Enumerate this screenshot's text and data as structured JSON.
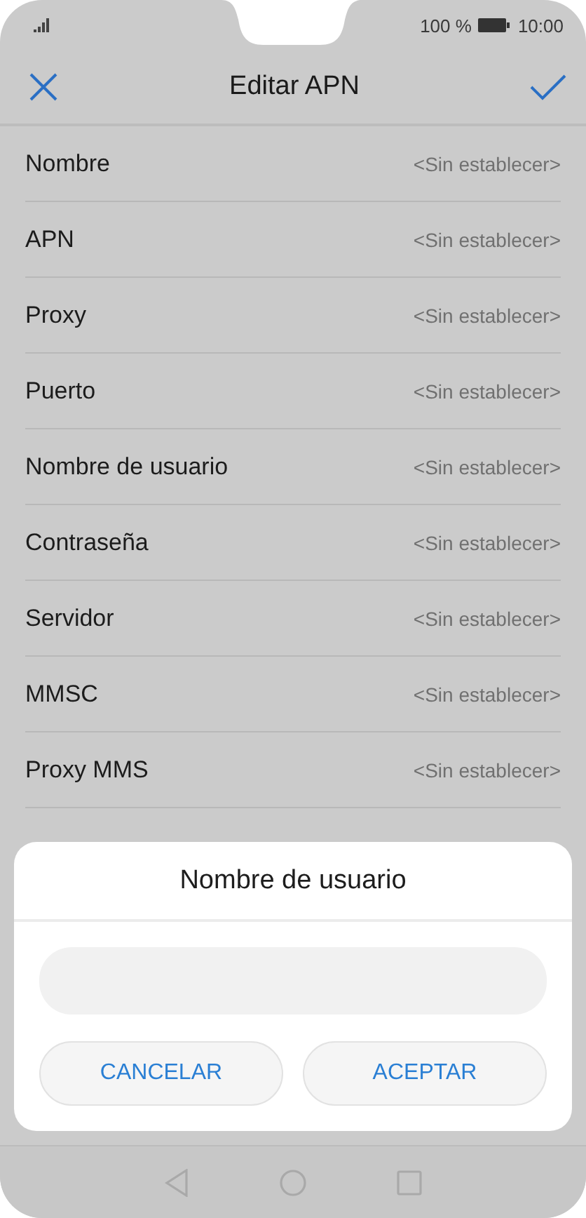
{
  "status_bar": {
    "battery_text": "100 %",
    "time": "10:00"
  },
  "header": {
    "title": "Editar APN"
  },
  "settings": [
    {
      "label": "Nombre",
      "value": "<Sin establecer>"
    },
    {
      "label": "APN",
      "value": "<Sin establecer>"
    },
    {
      "label": "Proxy",
      "value": "<Sin establecer>"
    },
    {
      "label": "Puerto",
      "value": "<Sin establecer>"
    },
    {
      "label": "Nombre de usuario",
      "value": "<Sin establecer>"
    },
    {
      "label": "Contraseña",
      "value": "<Sin establecer>"
    },
    {
      "label": "Servidor",
      "value": "<Sin establecer>"
    },
    {
      "label": "MMSC",
      "value": "<Sin establecer>"
    },
    {
      "label": "Proxy MMS",
      "value": "<Sin establecer>"
    }
  ],
  "dialog": {
    "title": "Nombre de usuario",
    "buttons": [
      {
        "label": "CANCELAR"
      },
      {
        "label": "ACEPTAR"
      }
    ]
  }
}
